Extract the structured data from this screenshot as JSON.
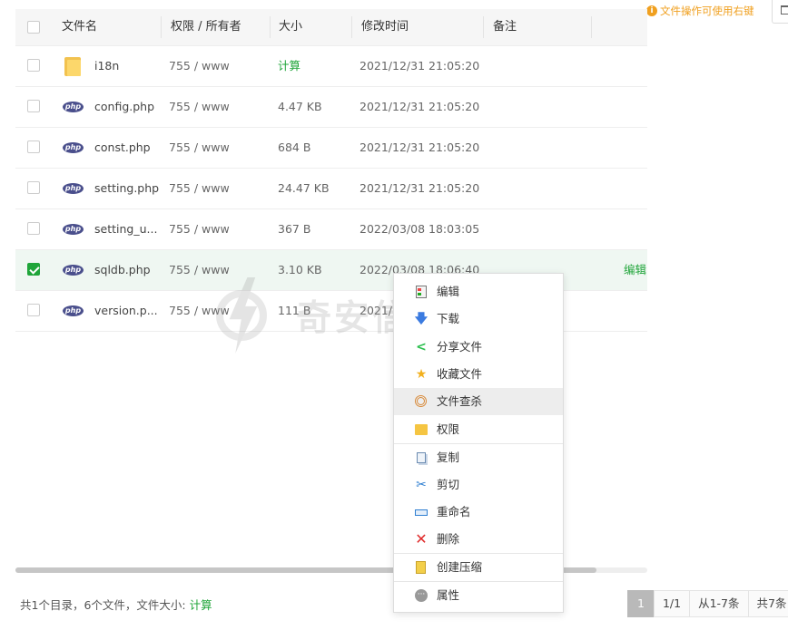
{
  "top_tip": {
    "icon": "info-circle-icon",
    "text": "文件操作可使用右键"
  },
  "top_button": {
    "icon": "trash-icon"
  },
  "table": {
    "columns": [
      "文件名",
      "权限 / 所有者",
      "大小",
      "修改时间",
      "备注"
    ],
    "rows": [
      {
        "type": "folder",
        "icon": "folder-icon",
        "name": "i18n",
        "perm": "755 / www",
        "size": "计算",
        "mtime": "2021/12/31 21:05:20",
        "note": "",
        "selected": false
      },
      {
        "type": "php",
        "icon": "php-file-icon",
        "name": "config.php",
        "perm": "755 / www",
        "size": "4.47 KB",
        "mtime": "2021/12/31 21:05:20",
        "note": "",
        "selected": false
      },
      {
        "type": "php",
        "icon": "php-file-icon",
        "name": "const.php",
        "perm": "755 / www",
        "size": "684 B",
        "mtime": "2021/12/31 21:05:20",
        "note": "",
        "selected": false
      },
      {
        "type": "php",
        "icon": "php-file-icon",
        "name": "setting.php",
        "perm": "755 / www",
        "size": "24.47 KB",
        "mtime": "2021/12/31 21:05:20",
        "note": "",
        "selected": false
      },
      {
        "type": "php",
        "icon": "php-file-icon",
        "name": "setting_u...",
        "perm": "755 / www",
        "size": "367 B",
        "mtime": "2022/03/08 18:03:05",
        "note": "",
        "selected": false
      },
      {
        "type": "php",
        "icon": "php-file-icon",
        "name": "sqldb.php",
        "perm": "755 / www",
        "size": "3.10 KB",
        "mtime": "2022/03/08 18:06:40",
        "note": "",
        "selected": true,
        "action": "编辑"
      },
      {
        "type": "php",
        "icon": "php-file-icon",
        "name": "version.p...",
        "perm": "755 / www",
        "size": "111 B",
        "mtime": "2021/",
        "note": "",
        "selected": false
      }
    ],
    "php_icon_text": "php"
  },
  "footer": {
    "summary_prefix": "共1个目录，6个文件，文件大小: ",
    "summary_link": "计算",
    "pager": {
      "current": "1",
      "pages": "1/1",
      "range": "从1-7条",
      "total": "共7条"
    }
  },
  "watermark": {
    "text": "奇安信攻防社区"
  },
  "context_menu": {
    "items": [
      {
        "label": "编辑",
        "icon": "edit-icon"
      },
      {
        "label": "下载",
        "icon": "download-icon"
      },
      {
        "label": "分享文件",
        "icon": "share-icon"
      },
      {
        "label": "收藏文件",
        "icon": "star-icon"
      },
      {
        "label": "文件查杀",
        "icon": "virus-scan-icon",
        "hover": true
      },
      {
        "label": "权限",
        "icon": "permission-folder-icon"
      },
      {
        "label": "复制",
        "icon": "copy-icon"
      },
      {
        "label": "剪切",
        "icon": "scissors-icon"
      },
      {
        "label": "重命名",
        "icon": "rename-icon"
      },
      {
        "label": "删除",
        "icon": "delete-x-icon"
      },
      {
        "label": "创建压缩",
        "icon": "archive-icon"
      },
      {
        "label": "属性",
        "icon": "more-dots-icon"
      }
    ]
  },
  "colors": {
    "accent_green": "#20a53a",
    "tip_orange": "#f0a020",
    "php_badge": "#4a4f8c"
  }
}
